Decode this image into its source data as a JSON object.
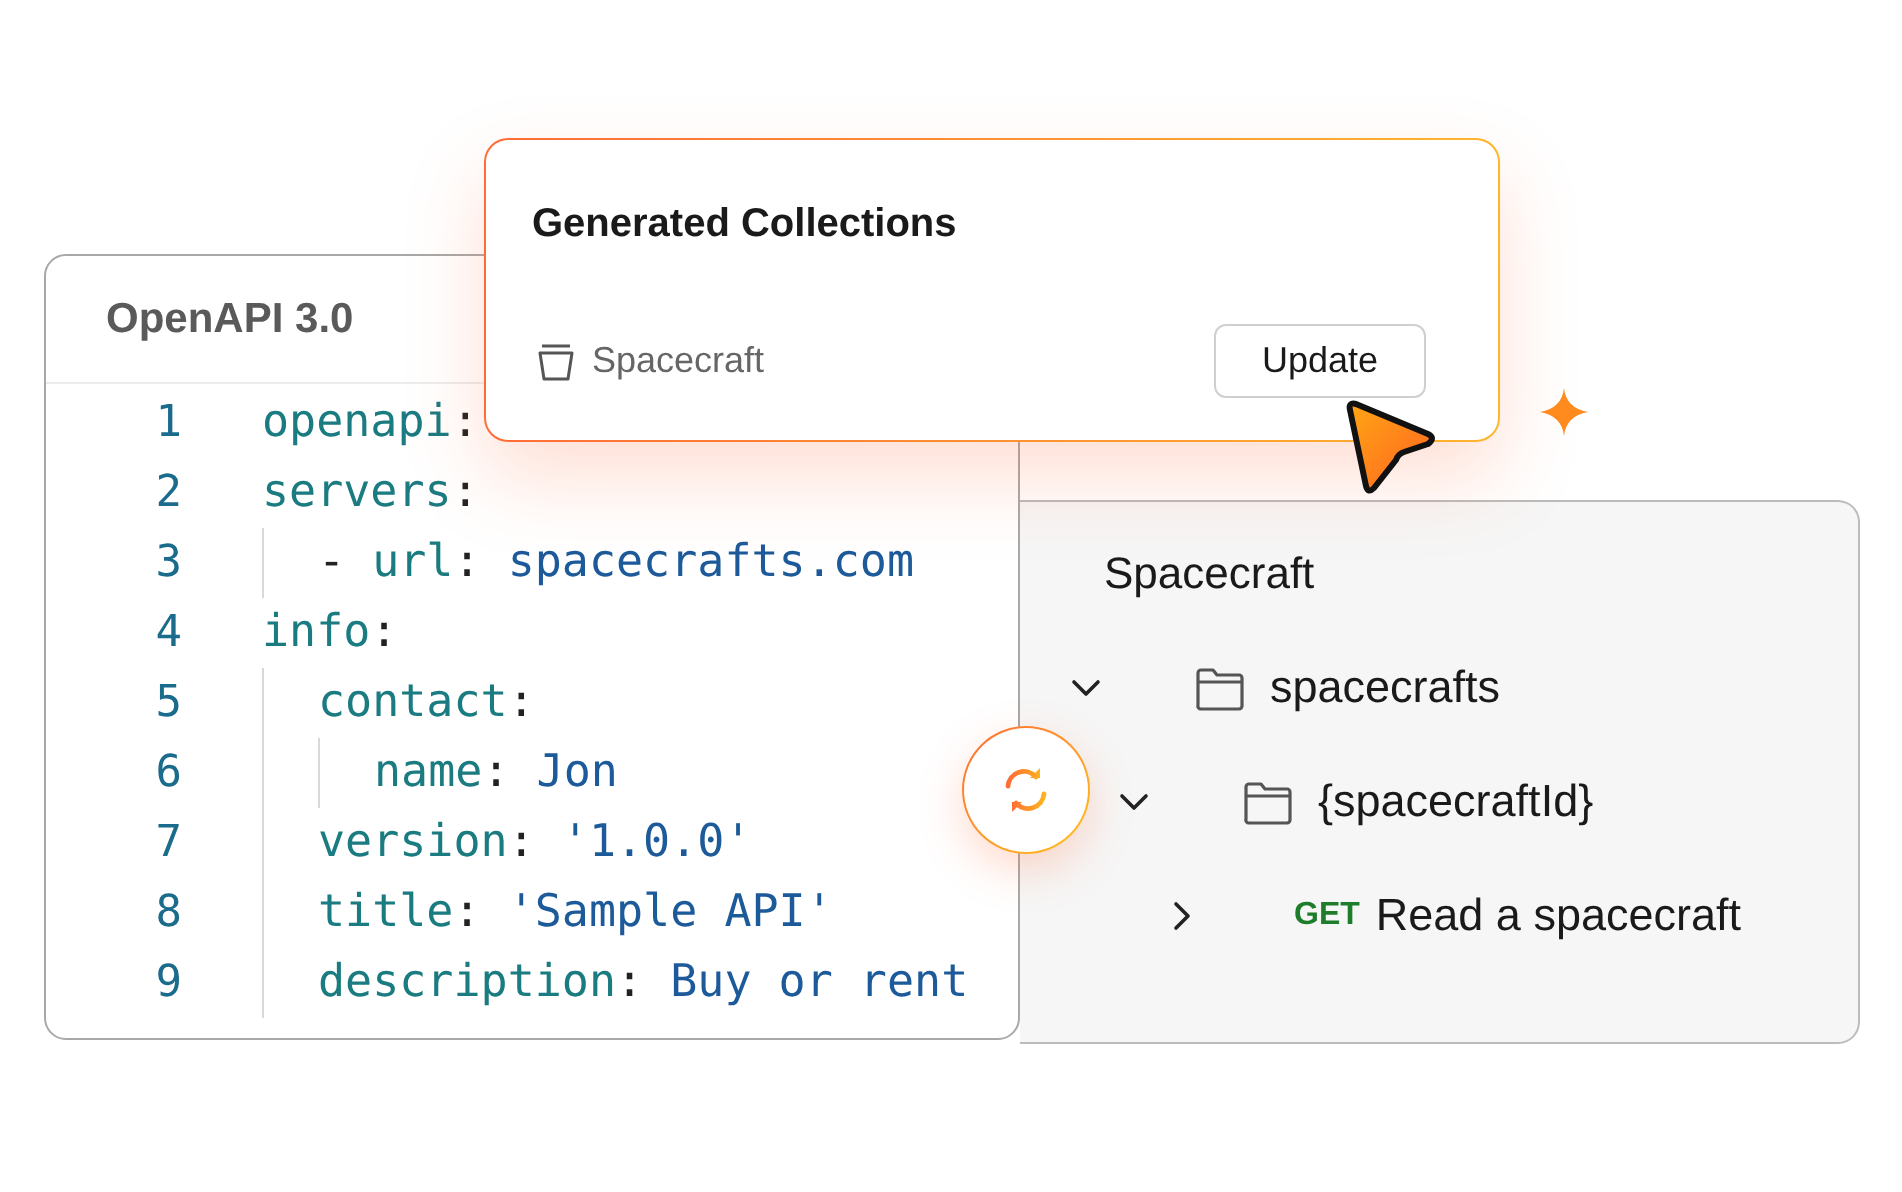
{
  "editor": {
    "title": "OpenAPI 3.0",
    "lines": [
      {
        "number": "1",
        "tokens": [
          {
            "text": "openapi",
            "kind": "key"
          },
          {
            "text": ":",
            "kind": "punct"
          }
        ]
      },
      {
        "number": "2",
        "tokens": [
          {
            "text": "servers",
            "kind": "key"
          },
          {
            "text": ":",
            "kind": "punct"
          }
        ],
        "children": [
          {
            "number": "3",
            "tokens": [
              {
                "text": "- ",
                "kind": "punct"
              },
              {
                "text": "url",
                "kind": "key"
              },
              {
                "text": ": ",
                "kind": "punct"
              },
              {
                "text": "spacecrafts.com",
                "kind": "value"
              }
            ]
          }
        ]
      },
      {
        "number": "4",
        "tokens": [
          {
            "text": "info",
            "kind": "key"
          },
          {
            "text": ":",
            "kind": "punct"
          }
        ],
        "children": [
          {
            "number": "5",
            "tokens": [
              {
                "text": "contact",
                "kind": "key"
              },
              {
                "text": ":",
                "kind": "punct"
              }
            ],
            "children": [
              {
                "number": "6",
                "tokens": [
                  {
                    "text": "name",
                    "kind": "key"
                  },
                  {
                    "text": ": ",
                    "kind": "punct"
                  },
                  {
                    "text": "Jon",
                    "kind": "value"
                  }
                ]
              }
            ]
          },
          {
            "number": "7",
            "tokens": [
              {
                "text": "version",
                "kind": "key"
              },
              {
                "text": ": ",
                "kind": "punct"
              },
              {
                "text": "'1.0.0'",
                "kind": "value"
              }
            ]
          },
          {
            "number": "8",
            "tokens": [
              {
                "text": "title",
                "kind": "key"
              },
              {
                "text": ": ",
                "kind": "punct"
              },
              {
                "text": "'Sample API'",
                "kind": "value"
              }
            ]
          },
          {
            "number": "9",
            "tokens": [
              {
                "text": "description",
                "kind": "key"
              },
              {
                "text": ": ",
                "kind": "punct"
              },
              {
                "text": "Buy or rent",
                "kind": "value"
              }
            ]
          }
        ]
      }
    ]
  },
  "collection": {
    "title": "Spacecraft",
    "tree": [
      {
        "kind": "folder",
        "label": "spacecrafts",
        "expanded": true,
        "children": [
          {
            "kind": "folder",
            "label": "{spacecraftId}",
            "expanded": true,
            "children": [
              {
                "kind": "request",
                "method": "GET",
                "label": "Read a spacecraft",
                "expanded": false
              }
            ]
          }
        ]
      }
    ]
  },
  "popup": {
    "title": "Generated Collections",
    "collection": "Spacecraft",
    "button": "Update"
  }
}
